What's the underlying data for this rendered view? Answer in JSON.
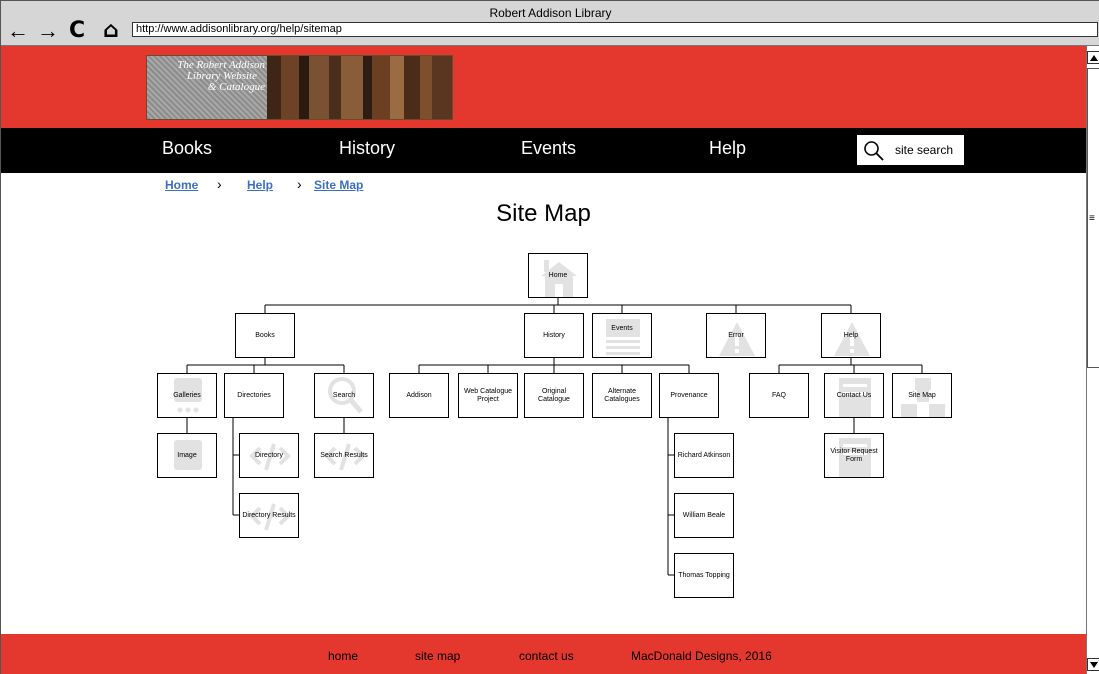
{
  "browser": {
    "window_title": "Robert Addison Library",
    "url": "http://www.addisonlibrary.org/help/sitemap",
    "back_icon": "←",
    "forward_icon": "→",
    "reload_icon": "C",
    "home_icon": "⌂"
  },
  "header": {
    "logo_line1": "The Robert Addison",
    "logo_line2": "Library Website",
    "logo_line3": "& Catalogue",
    "brand_color": "#e4372e"
  },
  "nav": {
    "books": "Books",
    "history": "History",
    "events": "Events",
    "help": "Help",
    "search_placeholder": "site search"
  },
  "breadcrumb": {
    "home": "Home",
    "help": "Help",
    "sitemap": "Site Map",
    "separator": "›"
  },
  "page": {
    "title": "Site Map"
  },
  "sitemap": {
    "home": "Home",
    "books": "Books",
    "history": "History",
    "events": "Events",
    "error": "Error",
    "help": "Help",
    "galleries": "Galleries",
    "directories": "Directories",
    "search": "Search",
    "addison": "Addison",
    "web_catalogue_project": "Web Catalogue Project",
    "original_catalogue": "Original Catalogue",
    "alternate_catalogues": "Alternate Catalogues",
    "provenance": "Provenance",
    "faq": "FAQ",
    "contact_us": "Contact Us",
    "site_map": "Site Map",
    "image": "Image",
    "directory": "Directory",
    "search_results": "Search Results",
    "directory_results": "Directory Results",
    "richard_atkinson": "Richard Atkinson",
    "william_beale": "William Beale",
    "thomas_topping": "Thomas Topping",
    "visitor_request_form": "Visitor Request Form"
  },
  "footer": {
    "home": "home",
    "site_map": "site map",
    "contact_us": "contact us",
    "credit": "MacDonald Designs, 2016"
  }
}
